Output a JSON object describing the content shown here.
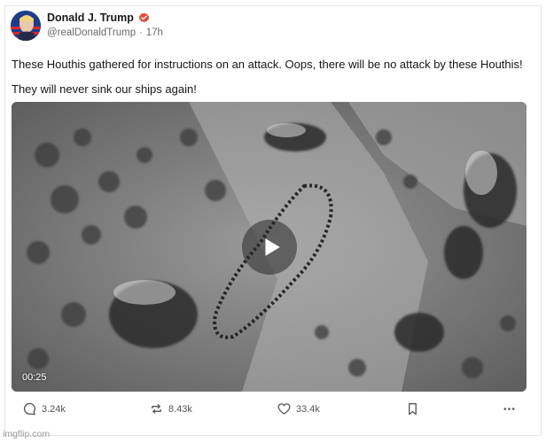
{
  "post": {
    "author": {
      "display_name": "Donald J. Trump",
      "handle": "@realDonaldTrump",
      "time_ago": "17h",
      "verified": true,
      "verified_color": "#e4473b"
    },
    "text": {
      "paragraph_1": "These Houthis gathered for instructions on an attack. Oops, there will be no attack by these Houthis!",
      "paragraph_2": "They will never sink our ships again!"
    },
    "media": {
      "type": "video",
      "duration": "00:25",
      "icon": "play-icon"
    }
  },
  "actions": {
    "reply_count": "3.24k",
    "retruth_count": "8.43k",
    "like_count": "33.4k",
    "reply_icon": "comment-icon",
    "retruth_icon": "repost-icon",
    "like_icon": "heart-icon",
    "bookmark_icon": "bookmark-icon",
    "more_icon": "more-horizontal-icon"
  },
  "watermark": "imgflip.com"
}
